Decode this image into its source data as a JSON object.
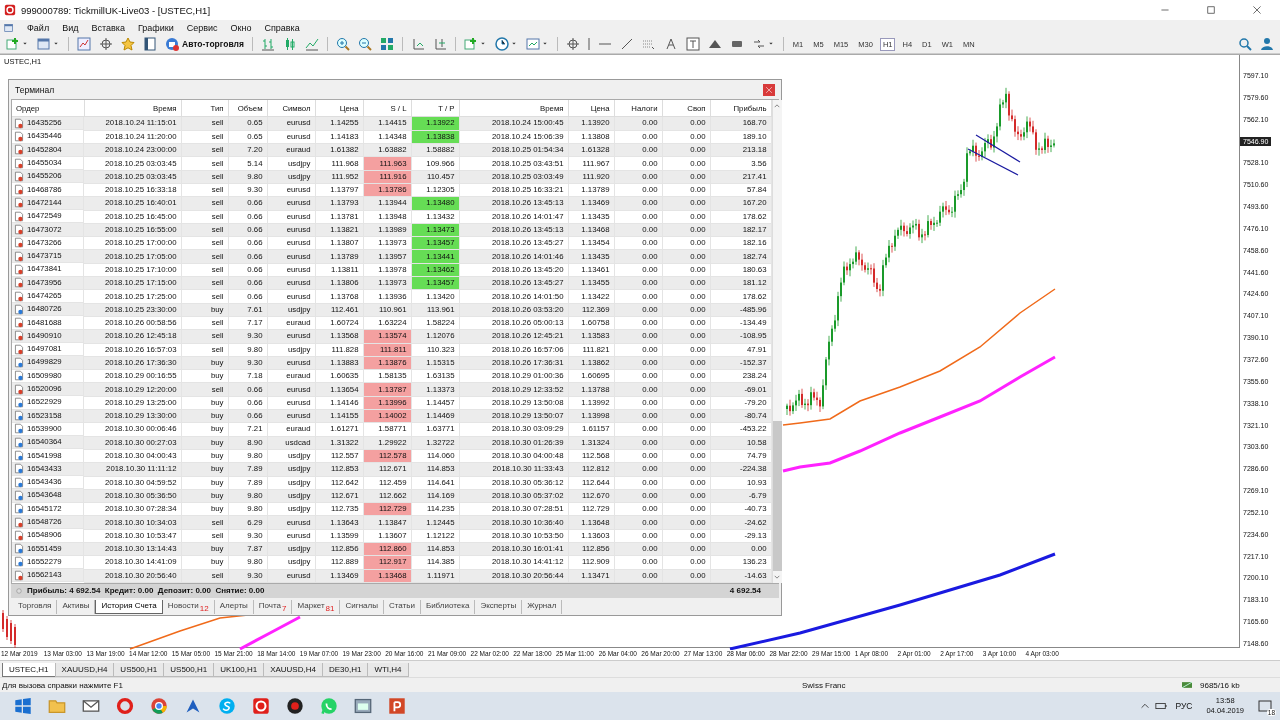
{
  "window": {
    "title": "999000789: TickmillUK-Live03 - [USTEC,H1]"
  },
  "menu": [
    "Файл",
    "Вид",
    "Вставка",
    "Графики",
    "Сервис",
    "Окно",
    "Справка"
  ],
  "toolbar": {
    "autotrade_label": "Авто-торговля",
    "timeframes": [
      {
        "label": "M1",
        "selected": false
      },
      {
        "label": "M5",
        "selected": false
      },
      {
        "label": "M15",
        "selected": false
      },
      {
        "label": "M30",
        "selected": false
      },
      {
        "label": "H1",
        "selected": true
      },
      {
        "label": "H4",
        "selected": false
      },
      {
        "label": "D1",
        "selected": false
      },
      {
        "label": "W1",
        "selected": false
      },
      {
        "label": "MN",
        "selected": false
      }
    ]
  },
  "chart": {
    "title": "USTEC,H1",
    "price_axis": [
      {
        "label": "7597.10",
        "current": false
      },
      {
        "label": "7579.60",
        "current": false
      },
      {
        "label": "7562.10",
        "current": false
      },
      {
        "label": "7546.90",
        "current": true
      },
      {
        "label": "7528.10",
        "current": false
      },
      {
        "label": "7510.60",
        "current": false
      },
      {
        "label": "7493.60",
        "current": false
      },
      {
        "label": "7476.10",
        "current": false
      },
      {
        "label": "7458.60",
        "current": false
      },
      {
        "label": "7441.60",
        "current": false
      },
      {
        "label": "7424.60",
        "current": false
      },
      {
        "label": "7407.10",
        "current": false
      },
      {
        "label": "7390.10",
        "current": false
      },
      {
        "label": "7372.60",
        "current": false
      },
      {
        "label": "7355.60",
        "current": false
      },
      {
        "label": "7338.10",
        "current": false
      },
      {
        "label": "7321.10",
        "current": false
      },
      {
        "label": "7303.60",
        "current": false
      },
      {
        "label": "7286.60",
        "current": false
      },
      {
        "label": "7269.10",
        "current": false
      },
      {
        "label": "7252.10",
        "current": false
      },
      {
        "label": "7234.60",
        "current": false
      },
      {
        "label": "7217.10",
        "current": false
      },
      {
        "label": "7200.10",
        "current": false
      },
      {
        "label": "7183.10",
        "current": false
      },
      {
        "label": "7165.60",
        "current": false
      },
      {
        "label": "7148.60",
        "current": false
      }
    ],
    "time_axis": [
      "12 Mar 2019",
      "13 Mar 03:00",
      "13 Mar 19:00",
      "14 Mar 12:00",
      "15 Mar 05:00",
      "15 Mar 21:00",
      "18 Mar 14:00",
      "19 Mar 07:00",
      "19 Mar 23:00",
      "20 Mar 16:00",
      "21 Mar 09:00",
      "22 Mar 02:00",
      "22 Mar 18:00",
      "25 Mar 11:00",
      "26 Mar 04:00",
      "26 Mar 20:00",
      "27 Mar 13:00",
      "28 Mar 06:00",
      "28 Mar 22:00",
      "29 Mar 15:00",
      "1 Apr 08:00",
      "2 Apr 01:00",
      "2 Apr 17:00",
      "3 Apr 10:00",
      "4 Apr 03:00"
    ]
  },
  "terminal": {
    "title": "Терминал",
    "columns": [
      "Ордер",
      "Время",
      "Тип",
      "Объем",
      "Символ",
      "Цена",
      "S / L",
      "T / P",
      "Время",
      "Цена",
      "Налоги",
      "Своп",
      "Прибыль"
    ],
    "rows": [
      {
        "kind": "sell",
        "order": "16435256",
        "open_time": "2018.10.24 11:15:01",
        "type": "sell",
        "volume": "0.65",
        "symbol": "eurusd",
        "price": "1.14255",
        "sl": "1.14415",
        "sl_hit": false,
        "tp": "1.13922",
        "tp_hit": true,
        "close_time": "2018.10.24 15:00:45",
        "close_price": "1.13920",
        "taxes": "0.00",
        "swap": "0.00",
        "profit": "168.70"
      },
      {
        "kind": "sell",
        "order": "16435446",
        "open_time": "2018.10.24 11:20:00",
        "type": "sell",
        "volume": "0.65",
        "symbol": "eurusd",
        "price": "1.14183",
        "sl": "1.14348",
        "sl_hit": false,
        "tp": "1.13838",
        "tp_hit": true,
        "close_time": "2018.10.24 15:06:39",
        "close_price": "1.13808",
        "taxes": "0.00",
        "swap": "0.00",
        "profit": "189.10"
      },
      {
        "kind": "sell",
        "order": "16452804",
        "open_time": "2018.10.24 23:00:00",
        "type": "sell",
        "volume": "7.20",
        "symbol": "euraud",
        "price": "1.61382",
        "sl": "1.63882",
        "sl_hit": false,
        "tp": "1.58882",
        "tp_hit": false,
        "close_time": "2018.10.25 01:54:34",
        "close_price": "1.61328",
        "taxes": "0.00",
        "swap": "0.00",
        "profit": "213.18"
      },
      {
        "kind": "sell",
        "order": "16455034",
        "open_time": "2018.10.25 03:03:45",
        "type": "sell",
        "volume": "5.14",
        "symbol": "usdjpy",
        "price": "111.968",
        "sl": "111.963",
        "sl_hit": true,
        "tp": "109.966",
        "tp_hit": false,
        "close_time": "2018.10.25 03:43:51",
        "close_price": "111.967",
        "taxes": "0.00",
        "swap": "0.00",
        "profit": "3.56"
      },
      {
        "kind": "sell",
        "order": "16455206",
        "open_time": "2018.10.25 03:03:45",
        "type": "sell",
        "volume": "9.80",
        "symbol": "usdjpy",
        "price": "111.952",
        "sl": "111.916",
        "sl_hit": true,
        "tp": "110.457",
        "tp_hit": false,
        "close_time": "2018.10.25 03:03:49",
        "close_price": "111.920",
        "taxes": "0.00",
        "swap": "0.00",
        "profit": "217.41"
      },
      {
        "kind": "sell",
        "order": "16468786",
        "open_time": "2018.10.25 16:33:18",
        "type": "sell",
        "volume": "9.30",
        "symbol": "eurusd",
        "price": "1.13797",
        "sl": "1.13786",
        "sl_hit": true,
        "tp": "1.12305",
        "tp_hit": false,
        "close_time": "2018.10.25 16:33:21",
        "close_price": "1.13789",
        "taxes": "0.00",
        "swap": "0.00",
        "profit": "57.84"
      },
      {
        "kind": "sell",
        "order": "16472144",
        "open_time": "2018.10.25 16:40:01",
        "type": "sell",
        "volume": "0.66",
        "symbol": "eurusd",
        "price": "1.13793",
        "sl": "1.13944",
        "sl_hit": false,
        "tp": "1.13480",
        "tp_hit": true,
        "close_time": "2018.10.26 13:45:13",
        "close_price": "1.13469",
        "taxes": "0.00",
        "swap": "0.00",
        "profit": "167.20"
      },
      {
        "kind": "sell",
        "order": "16472549",
        "open_time": "2018.10.25 16:45:00",
        "type": "sell",
        "volume": "0.66",
        "symbol": "eurusd",
        "price": "1.13781",
        "sl": "1.13948",
        "sl_hit": false,
        "tp": "1.13432",
        "tp_hit": false,
        "close_time": "2018.10.26 14:01:47",
        "close_price": "1.13435",
        "taxes": "0.00",
        "swap": "0.00",
        "profit": "178.62"
      },
      {
        "kind": "sell",
        "order": "16473072",
        "open_time": "2018.10.25 16:55:00",
        "type": "sell",
        "volume": "0.66",
        "symbol": "eurusd",
        "price": "1.13821",
        "sl": "1.13989",
        "sl_hit": false,
        "tp": "1.13473",
        "tp_hit": true,
        "close_time": "2018.10.26 13:45:13",
        "close_price": "1.13468",
        "taxes": "0.00",
        "swap": "0.00",
        "profit": "182.17"
      },
      {
        "kind": "sell",
        "order": "16473266",
        "open_time": "2018.10.25 17:00:00",
        "type": "sell",
        "volume": "0.66",
        "symbol": "eurusd",
        "price": "1.13807",
        "sl": "1.13973",
        "sl_hit": false,
        "tp": "1.13457",
        "tp_hit": true,
        "close_time": "2018.10.26 13:45:27",
        "close_price": "1.13454",
        "taxes": "0.00",
        "swap": "0.00",
        "profit": "182.16"
      },
      {
        "kind": "sell",
        "order": "16473715",
        "open_time": "2018.10.25 17:05:00",
        "type": "sell",
        "volume": "0.66",
        "symbol": "eurusd",
        "price": "1.13789",
        "sl": "1.13957",
        "sl_hit": false,
        "tp": "1.13441",
        "tp_hit": true,
        "close_time": "2018.10.26 14:01:46",
        "close_price": "1.13435",
        "taxes": "0.00",
        "swap": "0.00",
        "profit": "182.74"
      },
      {
        "kind": "sell",
        "order": "16473841",
        "open_time": "2018.10.25 17:10:00",
        "type": "sell",
        "volume": "0.66",
        "symbol": "eurusd",
        "price": "1.13811",
        "sl": "1.13978",
        "sl_hit": false,
        "tp": "1.13462",
        "tp_hit": true,
        "close_time": "2018.10.26 13:45:20",
        "close_price": "1.13461",
        "taxes": "0.00",
        "swap": "0.00",
        "profit": "180.63"
      },
      {
        "kind": "sell",
        "order": "16473956",
        "open_time": "2018.10.25 17:15:00",
        "type": "sell",
        "volume": "0.66",
        "symbol": "eurusd",
        "price": "1.13806",
        "sl": "1.13973",
        "sl_hit": false,
        "tp": "1.13457",
        "tp_hit": true,
        "close_time": "2018.10.26 13:45:27",
        "close_price": "1.13455",
        "taxes": "0.00",
        "swap": "0.00",
        "profit": "181.12"
      },
      {
        "kind": "sell",
        "order": "16474265",
        "open_time": "2018.10.25 17:25:00",
        "type": "sell",
        "volume": "0.66",
        "symbol": "eurusd",
        "price": "1.13768",
        "sl": "1.13936",
        "sl_hit": false,
        "tp": "1.13420",
        "tp_hit": false,
        "close_time": "2018.10.26 14:01:50",
        "close_price": "1.13422",
        "taxes": "0.00",
        "swap": "0.00",
        "profit": "178.62"
      },
      {
        "kind": "buy",
        "order": "16480726",
        "open_time": "2018.10.25 23:30:00",
        "type": "buy",
        "volume": "7.61",
        "symbol": "usdjpy",
        "price": "112.461",
        "sl": "110.961",
        "sl_hit": false,
        "tp": "113.961",
        "tp_hit": false,
        "close_time": "2018.10.26 03:53:20",
        "close_price": "112.369",
        "taxes": "0.00",
        "swap": "0.00",
        "profit": "-485.96"
      },
      {
        "kind": "sell",
        "order": "16481688",
        "open_time": "2018.10.26 00:58:56",
        "type": "sell",
        "volume": "7.17",
        "symbol": "euraud",
        "price": "1.60724",
        "sl": "1.63224",
        "sl_hit": false,
        "tp": "1.58224",
        "tp_hit": false,
        "close_time": "2018.10.26 05:00:13",
        "close_price": "1.60758",
        "taxes": "0.00",
        "swap": "0.00",
        "profit": "-134.49"
      },
      {
        "kind": "sell",
        "order": "16490910",
        "open_time": "2018.10.26 12:45:18",
        "type": "sell",
        "volume": "9.30",
        "symbol": "eurusd",
        "price": "1.13568",
        "sl": "1.13574",
        "sl_hit": true,
        "tp": "1.12076",
        "tp_hit": false,
        "close_time": "2018.10.26 12:45:21",
        "close_price": "1.13583",
        "taxes": "0.00",
        "swap": "0.00",
        "profit": "-108.95"
      },
      {
        "kind": "sell",
        "order": "16497081",
        "open_time": "2018.10.26 16:57:03",
        "type": "sell",
        "volume": "9.80",
        "symbol": "usdjpy",
        "price": "111.828",
        "sl": "111.811",
        "sl_hit": true,
        "tp": "110.323",
        "tp_hit": false,
        "close_time": "2018.10.26 16:57:06",
        "close_price": "111.821",
        "taxes": "0.00",
        "swap": "0.00",
        "profit": "47.91"
      },
      {
        "kind": "buy",
        "order": "16499829",
        "open_time": "2018.10.26 17:36:30",
        "type": "buy",
        "volume": "9.30",
        "symbol": "eurusd",
        "price": "1.13883",
        "sl": "1.13876",
        "sl_hit": true,
        "tp": "1.15315",
        "tp_hit": false,
        "close_time": "2018.10.26 17:36:31",
        "close_price": "1.13862",
        "taxes": "0.00",
        "swap": "0.00",
        "profit": "-152.37"
      },
      {
        "kind": "buy",
        "order": "16509980",
        "open_time": "2018.10.29 00:16:55",
        "type": "buy",
        "volume": "7.18",
        "symbol": "euraud",
        "price": "1.60635",
        "sl": "1.58135",
        "sl_hit": false,
        "tp": "1.63135",
        "tp_hit": false,
        "close_time": "2018.10.29 01:00:36",
        "close_price": "1.60695",
        "taxes": "0.00",
        "swap": "0.00",
        "profit": "238.24"
      },
      {
        "kind": "sell",
        "order": "16520096",
        "open_time": "2018.10.29 12:20:00",
        "type": "sell",
        "volume": "0.66",
        "symbol": "eurusd",
        "price": "1.13654",
        "sl": "1.13787",
        "sl_hit": true,
        "tp": "1.13373",
        "tp_hit": false,
        "close_time": "2018.10.29 12:33:52",
        "close_price": "1.13788",
        "taxes": "0.00",
        "swap": "0.00",
        "profit": "-69.01"
      },
      {
        "kind": "buy",
        "order": "16522929",
        "open_time": "2018.10.29 13:25:00",
        "type": "buy",
        "volume": "0.66",
        "symbol": "eurusd",
        "price": "1.14146",
        "sl": "1.13996",
        "sl_hit": true,
        "tp": "1.14457",
        "tp_hit": false,
        "close_time": "2018.10.29 13:50:08",
        "close_price": "1.13992",
        "taxes": "0.00",
        "swap": "0.00",
        "profit": "-79.20"
      },
      {
        "kind": "buy",
        "order": "16523158",
        "open_time": "2018.10.29 13:30:00",
        "type": "buy",
        "volume": "0.66",
        "symbol": "eurusd",
        "price": "1.14155",
        "sl": "1.14002",
        "sl_hit": true,
        "tp": "1.14469",
        "tp_hit": false,
        "close_time": "2018.10.29 13:50:07",
        "close_price": "1.13998",
        "taxes": "0.00",
        "swap": "0.00",
        "profit": "-80.74"
      },
      {
        "kind": "buy",
        "order": "16539900",
        "open_time": "2018.10.30 00:06:46",
        "type": "buy",
        "volume": "7.21",
        "symbol": "euraud",
        "price": "1.61271",
        "sl": "1.58771",
        "sl_hit": false,
        "tp": "1.63771",
        "tp_hit": false,
        "close_time": "2018.10.30 03:09:29",
        "close_price": "1.61157",
        "taxes": "0.00",
        "swap": "0.00",
        "profit": "-453.22"
      },
      {
        "kind": "buy",
        "order": "16540364",
        "open_time": "2018.10.30 00:27:03",
        "type": "buy",
        "volume": "8.90",
        "symbol": "usdcad",
        "price": "1.31322",
        "sl": "1.29922",
        "sl_hit": false,
        "tp": "1.32722",
        "tp_hit": false,
        "close_time": "2018.10.30 01:26:39",
        "close_price": "1.31324",
        "taxes": "0.00",
        "swap": "0.00",
        "profit": "10.58"
      },
      {
        "kind": "buy",
        "order": "16541998",
        "open_time": "2018.10.30 04:00:43",
        "type": "buy",
        "volume": "9.80",
        "symbol": "usdjpy",
        "price": "112.557",
        "sl": "112.578",
        "sl_hit": true,
        "tp": "114.060",
        "tp_hit": false,
        "close_time": "2018.10.30 04:00:48",
        "close_price": "112.568",
        "taxes": "0.00",
        "swap": "0.00",
        "profit": "74.79"
      },
      {
        "kind": "buy",
        "order": "16543433",
        "open_time": "2018.10.30 11:11:12",
        "type": "buy",
        "volume": "7.89",
        "symbol": "usdjpy",
        "price": "112.853",
        "sl": "112.671",
        "sl_hit": false,
        "tp": "114.853",
        "tp_hit": false,
        "close_time": "2018.10.30 11:33:43",
        "close_price": "112.812",
        "taxes": "0.00",
        "swap": "0.00",
        "profit": "-224.38"
      },
      {
        "kind": "buy",
        "order": "16543436",
        "open_time": "2018.10.30 04:59:52",
        "type": "buy",
        "volume": "7.89",
        "symbol": "usdjpy",
        "price": "112.642",
        "sl": "112.459",
        "sl_hit": false,
        "tp": "114.641",
        "tp_hit": false,
        "close_time": "2018.10.30 05:36:12",
        "close_price": "112.644",
        "taxes": "0.00",
        "swap": "0.00",
        "profit": "10.93"
      },
      {
        "kind": "buy",
        "order": "16543648",
        "open_time": "2018.10.30 05:36:50",
        "type": "buy",
        "volume": "9.80",
        "symbol": "usdjpy",
        "price": "112.671",
        "sl": "112.662",
        "sl_hit": false,
        "tp": "114.169",
        "tp_hit": false,
        "close_time": "2018.10.30 05:37:02",
        "close_price": "112.670",
        "taxes": "0.00",
        "swap": "0.00",
        "profit": "-6.79"
      },
      {
        "kind": "buy",
        "order": "16545172",
        "open_time": "2018.10.30 07:28:34",
        "type": "buy",
        "volume": "9.80",
        "symbol": "usdjpy",
        "price": "112.735",
        "sl": "112.729",
        "sl_hit": true,
        "tp": "114.235",
        "tp_hit": false,
        "close_time": "2018.10.30 07:28:51",
        "close_price": "112.729",
        "taxes": "0.00",
        "swap": "0.00",
        "profit": "-40.73"
      },
      {
        "kind": "sell",
        "order": "16548726",
        "open_time": "2018.10.30 10:34:03",
        "type": "sell",
        "volume": "6.29",
        "symbol": "eurusd",
        "price": "1.13643",
        "sl": "1.13847",
        "sl_hit": false,
        "tp": "1.12445",
        "tp_hit": false,
        "close_time": "2018.10.30 10:36:40",
        "close_price": "1.13648",
        "taxes": "0.00",
        "swap": "0.00",
        "profit": "-24.62"
      },
      {
        "kind": "sell",
        "order": "16548906",
        "open_time": "2018.10.30 10:53:47",
        "type": "sell",
        "volume": "9.30",
        "symbol": "eurusd",
        "price": "1.13599",
        "sl": "1.13607",
        "sl_hit": false,
        "tp": "1.12122",
        "tp_hit": false,
        "close_time": "2018.10.30 10:53:50",
        "close_price": "1.13603",
        "taxes": "0.00",
        "swap": "0.00",
        "profit": "-29.13"
      },
      {
        "kind": "buy",
        "order": "16551459",
        "open_time": "2018.10.30 13:14:43",
        "type": "buy",
        "volume": "7.87",
        "symbol": "usdjpy",
        "price": "112.856",
        "sl": "112.860",
        "sl_hit": true,
        "tp": "114.853",
        "tp_hit": false,
        "close_time": "2018.10.30 16:01:41",
        "close_price": "112.856",
        "taxes": "0.00",
        "swap": "0.00",
        "profit": "0.00"
      },
      {
        "kind": "buy",
        "order": "16552279",
        "open_time": "2018.10.30 14:41:09",
        "type": "buy",
        "volume": "9.80",
        "symbol": "usdjpy",
        "price": "112.889",
        "sl": "112.917",
        "sl_hit": true,
        "tp": "114.385",
        "tp_hit": false,
        "close_time": "2018.10.30 14:41:12",
        "close_price": "112.909",
        "taxes": "0.00",
        "swap": "0.00",
        "profit": "136.23"
      },
      {
        "kind": "sell",
        "order": "16562143",
        "open_time": "2018.10.30 20:56:40",
        "type": "sell",
        "volume": "9.30",
        "symbol": "eurusd",
        "price": "1.13469",
        "sl": "1.13468",
        "sl_hit": true,
        "tp": "1.11971",
        "tp_hit": false,
        "close_time": "2018.10.30 20:56:44",
        "close_price": "1.13471",
        "taxes": "0.00",
        "swap": "0.00",
        "profit": "-14.63"
      }
    ],
    "summary": "Прибыль: 4 692.54  Кредит: 0.00  Депозит: 0.00  Снятие: 0.00",
    "total": "4 692.54",
    "tabs": [
      {
        "label": "Торговля",
        "selected": false
      },
      {
        "label": "Активы",
        "selected": false
      },
      {
        "label": "История Счета",
        "selected": true
      },
      {
        "label": "Новости",
        "badge": "12",
        "selected": false
      },
      {
        "label": "Алерты",
        "selected": false
      },
      {
        "label": "Почта",
        "badge": "7",
        "selected": false
      },
      {
        "label": "Маркет",
        "badge": "81",
        "selected": false
      },
      {
        "label": "Сигналы",
        "selected": false
      },
      {
        "label": "Статьи",
        "selected": false
      },
      {
        "label": "Библиотека",
        "selected": false
      },
      {
        "label": "Эксперты",
        "selected": false
      },
      {
        "label": "Журнал",
        "selected": false
      }
    ]
  },
  "chart_tabs": [
    {
      "label": "USTEC,H1",
      "selected": true
    },
    {
      "label": "XAUUSD,H4",
      "selected": false
    },
    {
      "label": "US500,H1",
      "selected": false
    },
    {
      "label": "US500,H1",
      "selected": false
    },
    {
      "label": "UK100,H1",
      "selected": false
    },
    {
      "label": "XAUUSD,H4",
      "selected": false
    },
    {
      "label": "DE30,H1",
      "selected": false
    },
    {
      "label": "WTI,H4",
      "selected": false
    }
  ],
  "status_bar": {
    "hint": "Для вызова справки нажмите F1",
    "symbol_name": "Swiss Franc",
    "traffic": "9685/16 kb"
  },
  "taskbar": {
    "language": "РУС",
    "time": "13:58",
    "date": "04.04.2019",
    "notifications": "18"
  }
}
